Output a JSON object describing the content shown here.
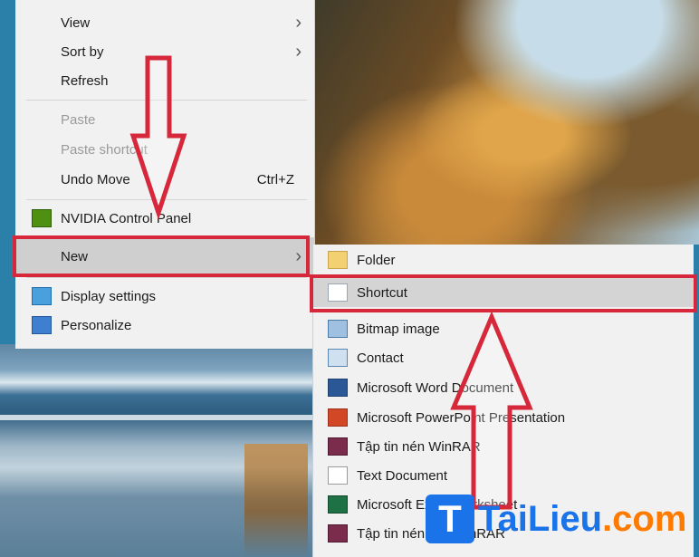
{
  "context_menu": {
    "items": [
      {
        "label": "View",
        "has_submenu": true,
        "enabled": true
      },
      {
        "label": "Sort by",
        "has_submenu": true,
        "enabled": true
      },
      {
        "label": "Refresh",
        "enabled": true
      },
      {
        "label": "Paste",
        "enabled": false
      },
      {
        "label": "Paste shortcut",
        "enabled": false
      },
      {
        "label": "Undo Move",
        "shortcut": "Ctrl+Z",
        "enabled": true
      },
      {
        "label": "NVIDIA Control Panel",
        "icon": "nvidia-icon",
        "enabled": true
      },
      {
        "label": "New",
        "has_submenu": true,
        "highlighted": true,
        "enabled": true
      },
      {
        "label": "Display settings",
        "icon": "display-settings-icon",
        "enabled": true
      },
      {
        "label": "Personalize",
        "icon": "personalize-icon",
        "enabled": true
      }
    ]
  },
  "new_submenu": {
    "items": [
      {
        "label": "Folder",
        "icon": "folder-icon"
      },
      {
        "label": "Shortcut",
        "icon": "shortcut-icon",
        "highlighted": true
      },
      {
        "label": "Bitmap image",
        "icon": "bitmap-icon"
      },
      {
        "label": "Contact",
        "icon": "contact-icon"
      },
      {
        "label": "Microsoft Word Document",
        "icon": "word-icon"
      },
      {
        "label": "Microsoft PowerPoint Presentation",
        "icon": "powerpoint-icon"
      },
      {
        "label": "Tập tin nén WinRAR",
        "icon": "winrar-icon"
      },
      {
        "label": "Text Document",
        "icon": "text-document-icon"
      },
      {
        "label": "Microsoft Excel Worksheet",
        "icon": "excel-icon"
      },
      {
        "label": "Tập tin nén ZIP WinRAR",
        "icon": "winrar-zip-icon"
      }
    ]
  },
  "watermark": {
    "part1": "TaiLieu",
    "part2": ".com",
    "logo_letter": "T"
  },
  "colors": {
    "highlight_box": "#d6283a",
    "menu_bg": "#f1f1f1",
    "brand_blue": "#1a73e8",
    "brand_orange": "#ff7a00"
  }
}
